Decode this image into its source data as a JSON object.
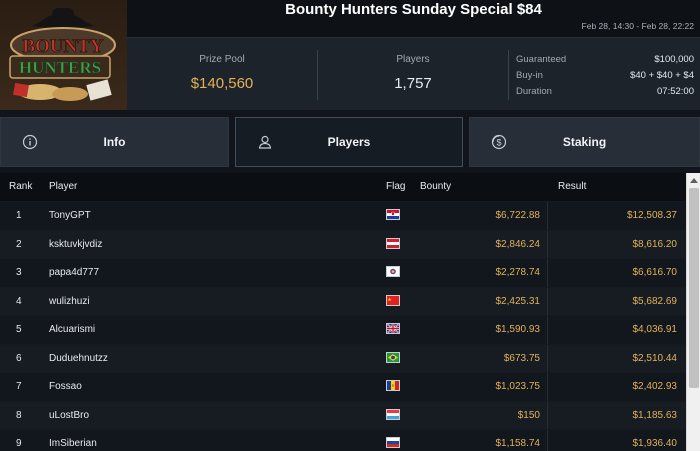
{
  "header": {
    "title": "Bounty Hunters Sunday Special $84",
    "dates": "Feb 28, 14:30 - Feb 28, 22:22"
  },
  "logo": {
    "line1": "BOUNTY",
    "line2": "HUNTERS"
  },
  "stats": {
    "prize_pool_label": "Prize Pool",
    "prize_pool_value": "$140,560",
    "players_label": "Players",
    "players_value": "1,757",
    "details": [
      {
        "key": "Guaranteed",
        "value": "$100,000"
      },
      {
        "key": "Buy-in",
        "value": "$40 + $40 + $4"
      },
      {
        "key": "Duration",
        "value": "07:52:00"
      }
    ]
  },
  "tabs": [
    {
      "label": "Info",
      "icon": "info-icon"
    },
    {
      "label": "Players",
      "icon": "user-icon"
    },
    {
      "label": "Staking",
      "icon": "dollar-icon"
    }
  ],
  "table": {
    "columns": {
      "rank": "Rank",
      "player": "Player",
      "flag": "Flag",
      "bounty": "Bounty",
      "result": "Result"
    },
    "rows": [
      {
        "rank": "1",
        "player": "TonyGPT",
        "flag": "croatia",
        "bounty": "$6,722.88",
        "result": "$12,508.37"
      },
      {
        "rank": "2",
        "player": "ksktuvkjvdiz",
        "flag": "austria",
        "bounty": "$2,846.24",
        "result": "$8,616.20"
      },
      {
        "rank": "3",
        "player": "papa4d777",
        "flag": "unknown",
        "bounty": "$2,278.74",
        "result": "$6,616.70"
      },
      {
        "rank": "4",
        "player": "wulizhuzi",
        "flag": "china",
        "bounty": "$2,425.31",
        "result": "$5,682.69"
      },
      {
        "rank": "5",
        "player": "Alcuarismi",
        "flag": "united-kingdom",
        "bounty": "$1,590.93",
        "result": "$4,036.91"
      },
      {
        "rank": "6",
        "player": "Duduehnutzz",
        "flag": "brazil",
        "bounty": "$673.75",
        "result": "$2,510.44"
      },
      {
        "rank": "7",
        "player": "Fossao",
        "flag": "andorra",
        "bounty": "$1,023.75",
        "result": "$2,402.93"
      },
      {
        "rank": "8",
        "player": "uLostBro",
        "flag": "luxembourg",
        "bounty": "$150",
        "result": "$1,185.63"
      },
      {
        "rank": "9",
        "player": "ImSiberian",
        "flag": "russia",
        "bounty": "$1,158.74",
        "result": "$1,936.40"
      }
    ]
  },
  "colors": {
    "accent_gold": "#e2b15a",
    "background": "#11151b"
  }
}
